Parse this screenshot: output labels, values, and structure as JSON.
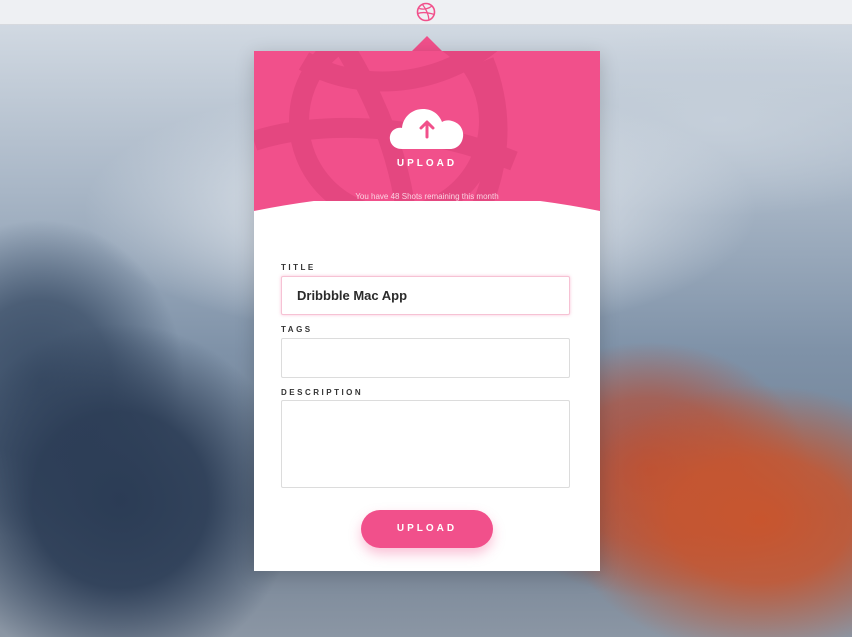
{
  "colors": {
    "accent": "#f1508b",
    "topbar": "#eef0f3"
  },
  "topbar": {
    "logo_icon": "dribbble-icon"
  },
  "hero": {
    "cloud_icon": "cloud-upload-icon",
    "upload_label": "UPLOAD",
    "shots_text": "You have 48 Shots remaining this month"
  },
  "form": {
    "title_label": "TITLE",
    "title_value": "Dribbble Mac App",
    "tags_label": "TAGS",
    "tags_value": "",
    "description_label": "DESCRIPTION",
    "description_value": "",
    "submit_label": "UPLOAD"
  }
}
